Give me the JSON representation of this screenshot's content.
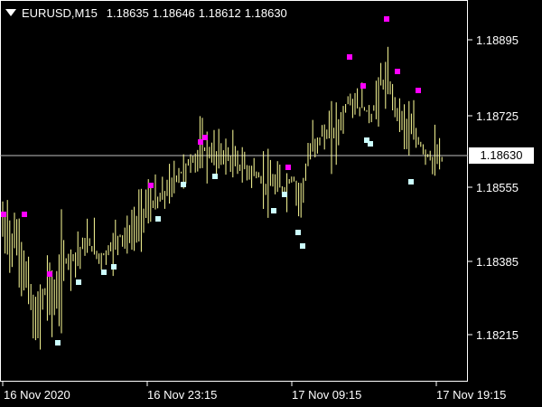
{
  "header": {
    "symbol": "EURUSD,M15",
    "open": "1.18635",
    "high": "1.18646",
    "low": "1.18612",
    "close": "1.18630"
  },
  "current_price": "1.18630",
  "colors": {
    "background": "#000000",
    "candle": "#ffff99",
    "top_marker": "#ff00ff",
    "bottom_marker": "#ccffff",
    "axis": "#ffffff"
  },
  "chart_data": {
    "type": "candlestick",
    "title": "EURUSD,M15",
    "y_ticks": [
      "1.18895",
      "1.18725",
      "1.18555",
      "1.18385",
      "1.18215"
    ],
    "x_ticks": [
      "16 Nov 2020",
      "16 Nov 23:15",
      "17 Nov 09:15",
      "17 Nov 19:15"
    ],
    "ylim": [
      1.1808,
      1.1904
    ],
    "current_price_line": 1.1863,
    "grid": false
  }
}
